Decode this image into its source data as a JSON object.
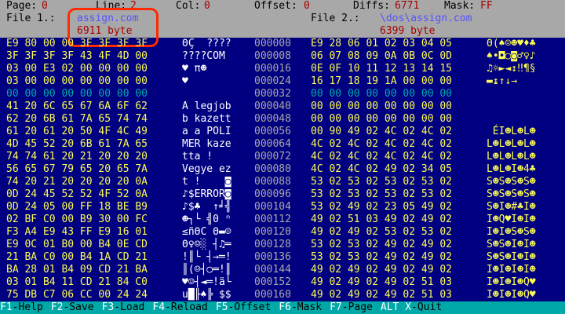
{
  "header": {
    "page_label": "Page:",
    "page_value": "0",
    "line_label": "Line:",
    "line_value": "2",
    "col_label": "Col:",
    "col_value": "0",
    "offset_label": "Offset:",
    "offset_value": "0",
    "diffs_label": "Diffs:",
    "diffs_value": "6771",
    "mask_label": "Mask:",
    "mask_value": "FF",
    "file1_label": "File 1.:",
    "file1_name": "assign.com",
    "file1_size": "6911 byte",
    "file2_label": "File 2.:",
    "file2_name": "\\dos\\assign.com",
    "file2_size": "6399 byte"
  },
  "rows": [
    {
      "offset": "000000",
      "left_hex": "E9 80 00 00 3F 3F 3F 3F",
      "left_ascii": "ΘÇ  ????",
      "right_hex": "E9 28 06 01 02 03 04 05",
      "right_ascii": "Θ(♠☺☻♥♦♣"
    },
    {
      "offset": "000008",
      "left_hex": "3F 3F 3F 3F 43 4F 4D 00",
      "left_ascii": "????COM ",
      "right_hex": "06 07 08 09 0A 0B 0C 0D",
      "right_ascii": "♠•◘○◙♂♀♪"
    },
    {
      "offset": "000016",
      "left_hex": "03 00 E3 02 00 00 00 00",
      "left_ascii": "♥ π☻    ",
      "right_hex": "0E 0F 10 11 12 13 14 15",
      "right_ascii": "♫☼►◄↕‼¶§"
    },
    {
      "offset": "000024",
      "left_hex": "03 00 00 00 00 00 00 00",
      "left_ascii": "♥       ",
      "right_hex": "16 17 18 19 1A 00 00 00",
      "right_ascii": "▬↨↑↓→   "
    },
    {
      "offset": "000032",
      "left_hex": "00 00 00 00 00 00 00 00",
      "left_ascii": "        ",
      "right_hex": "00 00 00 00 00 00 00 00",
      "right_ascii": "        "
    },
    {
      "offset": "000040",
      "left_hex": "41 20 6C 65 67 6A 6F 62",
      "left_ascii": "A legjob ",
      "right_hex": "00 00 00 00 00 00 00 00",
      "right_ascii": "        "
    },
    {
      "offset": "000048",
      "left_hex": "62 20 6B 61 7A 65 74 74",
      "left_ascii": "b kazett",
      "right_hex": "00 00 00 00 00 00 00 00",
      "right_ascii": "        "
    },
    {
      "offset": "000056",
      "left_hex": "61 20 61 20 50 4F 4C 49",
      "left_ascii": "a a POLI",
      "right_hex": "00 90 49 02 4C 02 4C 02",
      "right_ascii": " ÉI☻L☻L☻"
    },
    {
      "offset": "000064",
      "left_hex": "4D 45 52 20 6B 61 7A 65",
      "left_ascii": "MER kaze",
      "right_hex": "4C 02 4C 02 4C 02 4C 02",
      "right_ascii": "L☻L☻L☻L☻"
    },
    {
      "offset": "000072",
      "left_hex": "74 74 61 20 21 20 20 20",
      "left_ascii": "tta !   ",
      "right_hex": "4C 02 4C 02 4C 02 4C 02",
      "right_ascii": "L☻L☻L☻L☻"
    },
    {
      "offset": "000080",
      "left_hex": "56 65 67 79 65 20 65 7A",
      "left_ascii": "Vegye ez",
      "right_hex": "4C 02 4C 02 49 02 34 05",
      "right_ascii": "L☻L☻I☻4♣"
    },
    {
      "offset": "000088",
      "left_hex": "74 20 21 20 20 20 20 0A",
      "left_ascii": "t !    ◙",
      "right_hex": "53 02 53 02 53 02 53 02",
      "right_ascii": "S☻S☻S☻S☻"
    },
    {
      "offset": "000096",
      "left_hex": "0D 24 45 52 52 4F 52 0A",
      "left_ascii": "♪$ERROR◙",
      "right_hex": "53 02 53 02 53 02 53 02",
      "right_ascii": "S☻S☻S☻S☻"
    },
    {
      "offset": "000104",
      "left_hex": "0D 24 05 00 FF 18 BE B9",
      "left_ascii": "♪$♣  ↑╛╣",
      "right_hex": "53 02 49 02 23 05 49 02",
      "right_ascii": "S☻I☻#♣I☻"
    },
    {
      "offset": "000112",
      "left_hex": "02 BF C0 00 B9 30 00 FC",
      "left_ascii": "☻┐└ ╣0 ⁿ",
      "right_hex": "49 02 51 03 49 02 49 02",
      "right_ascii": "I☻Q♥I☻I☻"
    },
    {
      "offset": "000120",
      "left_hex": "F3 A4 E9 43 FF E9 16 01",
      "left_ascii": "≤ñΘC Θ▬☺",
      "right_hex": "49 02 49 02 53 02 53 02",
      "right_ascii": "I☻I☻S☻S☻"
    },
    {
      "offset": "000128",
      "left_hex": "E9 0C 01 B0 00 B4 0E CD",
      "left_ascii": "Θ♀☺░ ┤♫═",
      "right_hex": "53 02 53 02 49 02 49 02",
      "right_ascii": "S☻S☻I☻I☻"
    },
    {
      "offset": "000136",
      "left_hex": "21 BA C0 00 B4 1A CD 21",
      "left_ascii": "!║└ ┤→═!",
      "right_hex": "53 02 53 02 49 02 49 02",
      "right_ascii": "S☻S☻I☻I☻"
    },
    {
      "offset": "000144",
      "left_hex": "BA 28 01 B4 09 CD 21 BA",
      "left_ascii": "║(☺┤○═!║",
      "right_hex": "49 02 49 02 49 02 49 02",
      "right_ascii": "I☻I☻I☻I☻"
    },
    {
      "offset": "000152",
      "left_hex": "03 01 B4 11 CD 21 84 C0",
      "left_ascii": "♥☺┤◄═!ä└",
      "right_hex": "49 02 49 02 49 02 51 03",
      "right_ascii": "I☻I☻I☻Q♥"
    },
    {
      "offset": "000160",
      "left_hex": "75 DB C7 06 CC 00 24 24",
      "left_ascii": "u█╟♠╠ $$",
      "right_hex": "49 02 49 02 49 02 51 03",
      "right_ascii": "I☻I☻I☻Q♥"
    }
  ],
  "footer": [
    {
      "key": "F1",
      "label": "-Help"
    },
    {
      "key": "F2",
      "label": "-Save"
    },
    {
      "key": "F3",
      "label": "-Load"
    },
    {
      "key": "F4",
      "label": "-Reload"
    },
    {
      "key": "F5",
      "label": "-Offset"
    },
    {
      "key": "F6",
      "label": "-Mask"
    },
    {
      "key": "F7",
      "label": "-Page"
    },
    {
      "key": "ALT X",
      "label": "-Quit"
    }
  ],
  "colors": {
    "background": "#000080",
    "header": "#a8a8a8",
    "diff": "#fcfc54",
    "same": "#00a8a8",
    "footer": "#00a8a8",
    "marker": "#ff2a00"
  }
}
